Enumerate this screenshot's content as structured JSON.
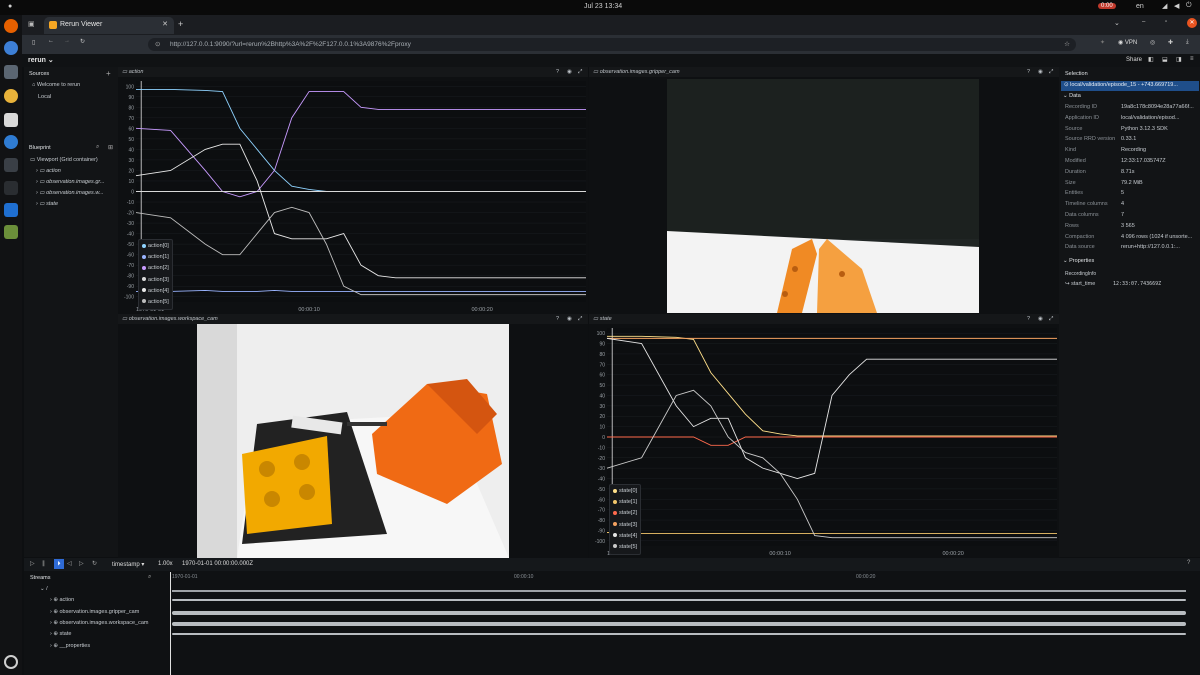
{
  "system": {
    "clock": "Jul 23  13:34",
    "language": "en",
    "recording_indicator": "0:00"
  },
  "browser": {
    "tab_title": "Rerun Viewer",
    "new_tab": "+",
    "url": "http://127.0.0.1:9090/?url=rerun%2Bhttp%3A%2F%2F127.0.0.1%3A9876%2Fproxy",
    "vpn_label": "VPN"
  },
  "app": {
    "logo": "rerun",
    "share_label": "Share"
  },
  "sources": {
    "title": "Sources",
    "items": [
      "Welcome to rerun",
      "Local"
    ]
  },
  "blueprint": {
    "title": "Blueprint",
    "root": "Viewport (Grid container)",
    "items": [
      "action",
      "observation.images.gr...",
      "observation.images.w...",
      "state"
    ]
  },
  "views": {
    "action": {
      "title": "action",
      "time_ticks": [
        "1970-01-01",
        "00:00:10",
        "00:00:20"
      ],
      "legend": [
        "action[0]",
        "action[1]",
        "action[2]",
        "action[3]",
        "action[4]",
        "action[5]"
      ]
    },
    "gripper": {
      "title": "observation.images.gripper_cam"
    },
    "workspace": {
      "title": "observation.images.workspace_cam"
    },
    "state": {
      "title": "state",
      "time_ticks": [
        "1970-01-01",
        "00:00:10",
        "00:00:20"
      ],
      "legend": [
        "state[0]",
        "state[1]",
        "state[2]",
        "state[3]",
        "state[4]",
        "state[5]"
      ]
    }
  },
  "chart_data": [
    {
      "type": "line",
      "title": "action",
      "ylim": [
        -105,
        105
      ],
      "yticks": [
        100,
        90,
        80,
        70,
        60,
        50,
        40,
        30,
        20,
        10,
        0,
        -10,
        -20,
        -30,
        -40,
        -50,
        -60,
        -70,
        -80,
        -90,
        -100
      ],
      "x": [
        0,
        2,
        4,
        5,
        6,
        7,
        8,
        9,
        10,
        11,
        12,
        13,
        14,
        15,
        16,
        18,
        20,
        22,
        24,
        26
      ],
      "series": [
        {
          "name": "action[0]",
          "color": "#8fd3ff",
          "values": [
            97,
            97,
            96,
            95,
            60,
            40,
            20,
            5,
            2,
            0,
            0,
            0,
            0,
            0,
            0,
            0,
            0,
            0,
            0,
            0
          ]
        },
        {
          "name": "action[1]",
          "color": "#9ab4ff",
          "values": [
            -95,
            -95,
            -94,
            -95,
            -95,
            -95,
            -94,
            -95,
            -95,
            -95,
            -95,
            -95,
            -95,
            -95,
            -95,
            -95,
            -95,
            -95,
            -95,
            -95
          ]
        },
        {
          "name": "action[2]",
          "color": "#c89bff",
          "values": [
            60,
            58,
            20,
            0,
            -5,
            0,
            20,
            70,
            95,
            95,
            95,
            80,
            78,
            78,
            78,
            78,
            78,
            78,
            78,
            78
          ]
        },
        {
          "name": "action[3]",
          "color": "#d9d9d9",
          "values": [
            0,
            0,
            0,
            0,
            0,
            0,
            0,
            0,
            0,
            0,
            0,
            0,
            0,
            0,
            0,
            0,
            0,
            0,
            0,
            0
          ]
        },
        {
          "name": "action[4]",
          "color": "#e8e8e8",
          "values": [
            15,
            20,
            40,
            45,
            45,
            10,
            -40,
            -45,
            -45,
            -45,
            -40,
            -70,
            -80,
            -82,
            -82,
            -82,
            -82,
            -82,
            -82,
            -82
          ]
        },
        {
          "name": "action[5]",
          "color": "#bdbdbd",
          "values": [
            -20,
            -25,
            -50,
            -60,
            -60,
            -40,
            -20,
            -15,
            -20,
            -50,
            -90,
            -98,
            -98,
            -98,
            -98,
            -98,
            -98,
            -98,
            -98,
            -98
          ]
        }
      ]
    },
    {
      "type": "line",
      "title": "state",
      "ylim": [
        -105,
        105
      ],
      "yticks": [
        100,
        90,
        80,
        70,
        60,
        50,
        40,
        30,
        20,
        10,
        0,
        -10,
        -20,
        -30,
        -40,
        -50,
        -60,
        -70,
        -80,
        -90,
        -100
      ],
      "x": [
        0,
        2,
        4,
        5,
        6,
        7,
        8,
        9,
        10,
        11,
        12,
        13,
        14,
        15,
        16,
        18,
        20,
        22,
        24,
        26
      ],
      "series": [
        {
          "name": "state[0]",
          "color": "#ffe08a",
          "values": [
            97,
            97,
            96,
            94,
            62,
            42,
            22,
            6,
            3,
            1,
            1,
            1,
            1,
            1,
            1,
            1,
            1,
            1,
            1,
            1
          ]
        },
        {
          "name": "state[1]",
          "color": "#f2c66b",
          "values": [
            -92,
            -93,
            -93,
            -93,
            -93,
            -93,
            -93,
            -93,
            -93,
            -93,
            -93,
            -93,
            -93,
            -93,
            -93,
            -93,
            -93,
            -93,
            -93,
            -93
          ]
        },
        {
          "name": "state[2]",
          "color": "#ff6a4d",
          "values": [
            0,
            0,
            0,
            0,
            -8,
            -8,
            0,
            0,
            0,
            0,
            0,
            0,
            0,
            0,
            0,
            0,
            0,
            0,
            0,
            0
          ]
        },
        {
          "name": "state[3]",
          "color": "#f4a261",
          "values": [
            95,
            95,
            95,
            95,
            95,
            95,
            95,
            95,
            95,
            95,
            95,
            95,
            95,
            95,
            95,
            95,
            95,
            95,
            95,
            95
          ]
        },
        {
          "name": "state[4]",
          "color": "#e5e5e5",
          "values": [
            95,
            90,
            30,
            10,
            18,
            18,
            -20,
            -30,
            -35,
            -40,
            -35,
            40,
            60,
            75,
            75,
            75,
            75,
            75,
            75,
            75
          ]
        },
        {
          "name": "state[5]",
          "color": "#c9c9c9",
          "values": [
            -30,
            -20,
            40,
            45,
            30,
            0,
            -15,
            -20,
            -35,
            -60,
            -95,
            -97,
            -97,
            -97,
            -97,
            -97,
            -97,
            -97,
            -97,
            -97
          ]
        }
      ]
    }
  ],
  "selection": {
    "title": "Selection",
    "selected": "local/validation/episode_15 - +743.669719...",
    "data_header": "Data",
    "fields": [
      {
        "k": "Recording ID",
        "v": "19a8c178c8094e28a77a66f..."
      },
      {
        "k": "Application ID",
        "v": "local/validation/episod..."
      },
      {
        "k": "Source",
        "v": "Python 3.12.3 SDK"
      },
      {
        "k": "Source RRD version",
        "v": "0.33.1"
      },
      {
        "k": "Kind",
        "v": "Recording"
      },
      {
        "k": "Modified",
        "v": "12:33:17.035747Z"
      },
      {
        "k": "Duration",
        "v": "8.71s"
      },
      {
        "k": "Size",
        "v": "79.2 MiB"
      },
      {
        "k": "Entities",
        "v": "5"
      },
      {
        "k": "Timeline columns",
        "v": "4"
      },
      {
        "k": "Data columns",
        "v": "7"
      },
      {
        "k": "Rows",
        "v": "3 565"
      },
      {
        "k": "Compaction",
        "v": "4 096 rows (1024 if unsorte..."
      },
      {
        "k": "Data source",
        "v": "rerun+http://127.0.0.1:..."
      }
    ],
    "properties_header": "Properties",
    "recording_info": "RecordingInfo",
    "start_time_key": "start_time",
    "start_time_val": "12:33:07.743669Z"
  },
  "timeline": {
    "timeline_name": "timestamp",
    "speed": "1.00x",
    "current_time": "1970-01-01 00:00:00.000Z",
    "ruler": [
      "1970-01-01",
      "00:00:10",
      "00:00:20"
    ],
    "streams_title": "Streams",
    "streams": [
      "/",
      "action",
      "observation.images.gripper_cam",
      "observation.images.workspace_cam",
      "state",
      "__properties"
    ]
  }
}
